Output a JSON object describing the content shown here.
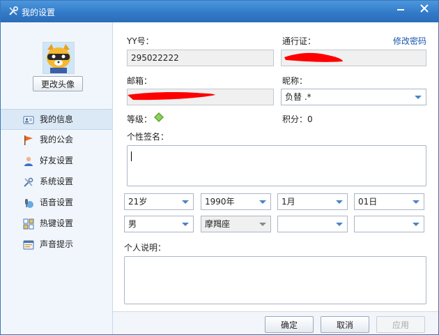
{
  "window": {
    "title": "我的设置",
    "controls": {
      "minimize": "minimize-icon",
      "close": "close-icon"
    }
  },
  "sidebar": {
    "change_avatar_label": "更改头像",
    "items": [
      {
        "label": "我的信息",
        "icon": "profile-card-icon",
        "active": true
      },
      {
        "label": "我的公会",
        "icon": "flag-icon",
        "active": false
      },
      {
        "label": "好友设置",
        "icon": "user-icon",
        "active": false
      },
      {
        "label": "系统设置",
        "icon": "tools-icon",
        "active": false
      },
      {
        "label": "语音设置",
        "icon": "microphone-globe-icon",
        "active": false
      },
      {
        "label": "热键设置",
        "icon": "keyboard-icon",
        "active": false
      },
      {
        "label": "声音提示",
        "icon": "sound-alert-icon",
        "active": false
      }
    ]
  },
  "profile": {
    "yy_label": "YY号：",
    "yy_value": "295022222",
    "passport_label": "通行证：",
    "change_password_link": "修改密码",
    "email_label": "邮箱：",
    "nickname_label": "昵称：",
    "nickname_value": "负替  .*",
    "level_label": "等级：",
    "points_label": "积分：0",
    "signature_label": "个性签名：",
    "age_value": "21岁",
    "year_value": "1990年",
    "month_value": "1月",
    "day_value": "01日",
    "gender_value": "男",
    "zodiac_value": "摩羯座",
    "province_value": "",
    "city_value": "",
    "description_label": "个人说明："
  },
  "footer": {
    "ok_label": "确定",
    "cancel_label": "取消",
    "apply_label": "应用"
  },
  "colors": {
    "titlebar": "#3179c7",
    "link": "#1a56b0",
    "redaction": "#ff0000",
    "sidebar_active": "#dbe8f6"
  }
}
